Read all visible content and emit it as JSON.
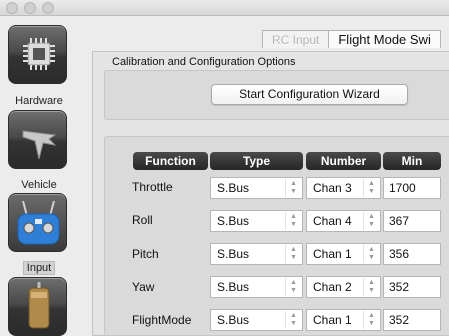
{
  "window": {
    "controls": [
      "close",
      "minimize",
      "zoom"
    ]
  },
  "sidebar": {
    "items": [
      {
        "label": "Hardware",
        "icon": "chip-icon"
      },
      {
        "label": "Vehicle",
        "icon": "plane-icon"
      },
      {
        "label": "Input",
        "icon": "transmitter-icon",
        "selected": true
      },
      {
        "label": "",
        "icon": "motor-icon"
      }
    ]
  },
  "tabs": [
    {
      "label": "RC Input",
      "active": false
    },
    {
      "label": "Flight Mode Swi",
      "active": true
    }
  ],
  "calibration": {
    "group_title": "Calibration and Configuration Options",
    "wizard_button": "Start Configuration Wizard"
  },
  "table": {
    "headers": [
      "Function",
      "Type",
      "Number",
      "Min"
    ],
    "rows": [
      {
        "function": "Throttle",
        "type": "S.Bus",
        "number": "Chan 3",
        "min": "1700"
      },
      {
        "function": "Roll",
        "type": "S.Bus",
        "number": "Chan 4",
        "min": "367"
      },
      {
        "function": "Pitch",
        "type": "S.Bus",
        "number": "Chan 1",
        "min": "356"
      },
      {
        "function": "Yaw",
        "type": "S.Bus",
        "number": "Chan 2",
        "min": "352"
      },
      {
        "function": "FlightMode",
        "type": "S.Bus",
        "number": "Chan 1",
        "min": "352"
      }
    ]
  },
  "colors": {
    "accent_blue": "#2f7fd6",
    "header_dark": "#2b2b2b"
  }
}
